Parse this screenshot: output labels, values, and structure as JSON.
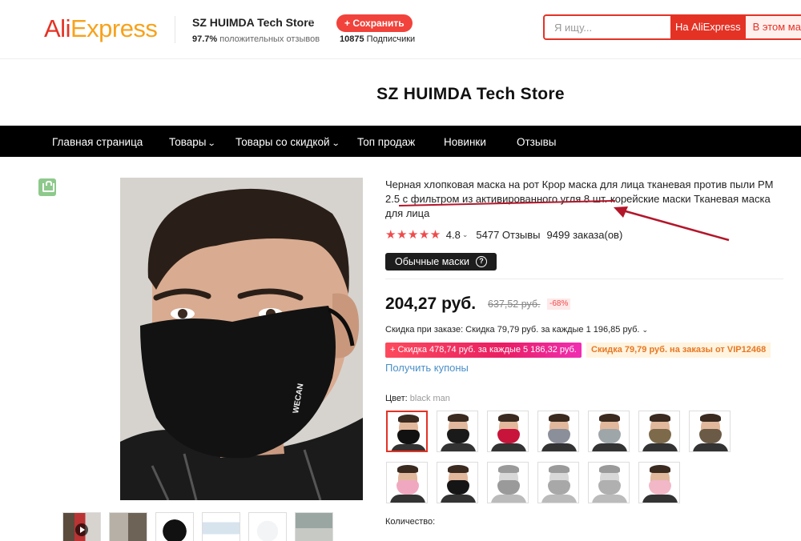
{
  "header": {
    "logo_part1": "Ali",
    "logo_part2": "Express",
    "store_name": "SZ HUIMDA Tech Store",
    "store_caret": "▼",
    "positive_percent": "97.7%",
    "positive_label": "положительных отзывов",
    "save_button": "+ Сохранить",
    "subscribers_count": "10875",
    "subscribers_label": "Подписчики",
    "search_placeholder": "Я ищу...",
    "search_aliexpress": "На AliExpress",
    "search_store": "В этом магазине"
  },
  "banner": {
    "title": "SZ HUIMDA Tech Store"
  },
  "nav": {
    "items": [
      {
        "label": "Главная страница",
        "dropdown": false
      },
      {
        "label": "Товары",
        "dropdown": true
      },
      {
        "label": "Товары со скидкой",
        "dropdown": true
      },
      {
        "label": "Топ продаж",
        "dropdown": false
      },
      {
        "label": "Новинки",
        "dropdown": false
      },
      {
        "label": "Отзывы",
        "dropdown": false
      }
    ]
  },
  "gallery": {
    "image_brand": "WECAN",
    "thumbnail_count": 6
  },
  "product": {
    "title": "Черная хлопковая маска на рот Крор маска для лица тканевая против пыли PM 2.5 с фильтром из активированного угля 8 шт. корейские маски Тканевая маска для лица",
    "stars": "★★★★★",
    "rating": "4.8",
    "reviews": "5477 Отзывы",
    "orders": "9499 заказа(ов)",
    "variant_label": "Обычные маски",
    "price": "204,27 руб.",
    "old_price": "637,52 руб.",
    "discount": "-68%",
    "order_discount": "Скидка при заказе: Скидка 79,79 руб. за каждые 1 196,85 руб.",
    "promo_1": "+ Скидка 478,74 руб. за каждые 5 186,32 руб.",
    "promo_2": "Скидка 79,79 руб. на заказы от VIP12468",
    "coupons": "Получить купоны",
    "color_label": "Цвет:",
    "color_value": "black man",
    "quantity_label": "Количество:"
  },
  "colors": {
    "accent": "#e43225",
    "nav_bg": "#000000",
    "link": "#4a90c8",
    "star": "#f04a4a"
  },
  "swatches": [
    {
      "mask": "#111111",
      "selected": true,
      "gray": false
    },
    {
      "mask": "#1a1a1a",
      "selected": false,
      "gray": false
    },
    {
      "mask": "#c8143a",
      "selected": false,
      "gray": false
    },
    {
      "mask": "#8a8f9a",
      "selected": false,
      "gray": false
    },
    {
      "mask": "#9ea6aa",
      "selected": false,
      "gray": false
    },
    {
      "mask": "#7d6a4a",
      "selected": false,
      "gray": false
    },
    {
      "mask": "#6b5a45",
      "selected": false,
      "gray": false
    },
    {
      "mask": "#f0a8c0",
      "selected": false,
      "gray": false
    },
    {
      "mask": "#151515",
      "selected": false,
      "gray": false
    },
    {
      "mask": "#9a9a9a",
      "selected": false,
      "gray": true
    },
    {
      "mask": "#a8a8a8",
      "selected": false,
      "gray": true
    },
    {
      "mask": "#b0b0b0",
      "selected": false,
      "gray": true
    },
    {
      "mask": "#f2b8c8",
      "selected": false,
      "gray": false
    }
  ]
}
